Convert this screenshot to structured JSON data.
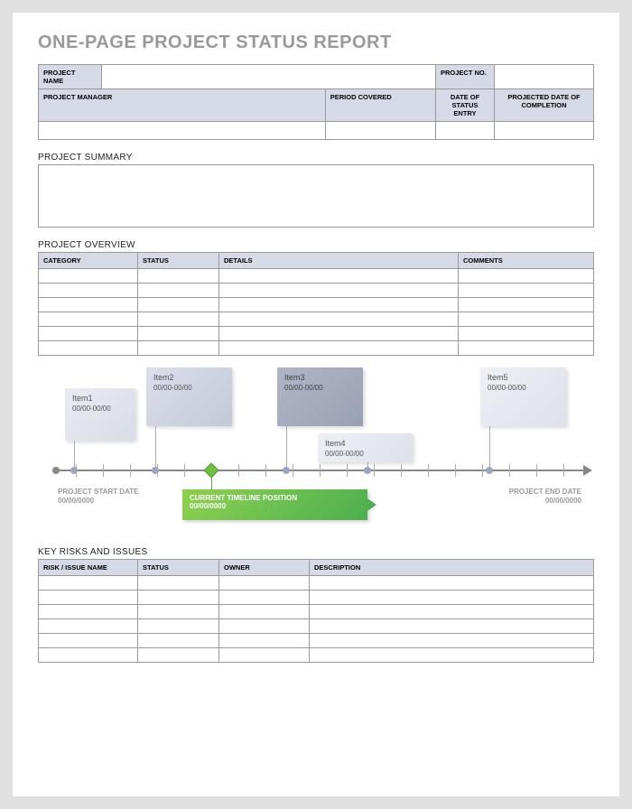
{
  "title": "ONE-PAGE PROJECT STATUS REPORT",
  "header": {
    "projectName": "PROJECT NAME",
    "projectNo": "PROJECT NO.",
    "projectManager": "PROJECT MANAGER",
    "periodCovered": "PERIOD COVERED",
    "dateStatusEntry": "DATE OF STATUS ENTRY",
    "projectedDate": "PROJECTED DATE OF COMPLETION"
  },
  "sections": {
    "summary": "PROJECT SUMMARY",
    "overview": "PROJECT OVERVIEW",
    "risks": "KEY RISKS AND ISSUES"
  },
  "overview": {
    "category": "CATEGORY",
    "status": "STATUS",
    "details": "DETAILS",
    "comments": "COMMENTS"
  },
  "risks": {
    "name": "RISK / ISSUE NAME",
    "status": "STATUS",
    "owner": "OWNER",
    "description": "DESCRIPTION"
  },
  "timeline": {
    "items": [
      {
        "name": "Item1",
        "date": "00/00-00/00"
      },
      {
        "name": "Item2",
        "date": "00/00-00/00"
      },
      {
        "name": "Item3",
        "date": "00/00-00/00"
      },
      {
        "name": "Item4",
        "date": "00/00-00/00"
      },
      {
        "name": "Item5",
        "date": "00/00-00/00"
      }
    ],
    "start": {
      "label": "PROJECT START DATE",
      "date": "00/00/0000"
    },
    "end": {
      "label": "PROJECT END DATE",
      "date": "00/00/0000"
    },
    "current": {
      "label": "CURRENT TIMELINE POSITION",
      "date": "00/00/0000"
    }
  }
}
